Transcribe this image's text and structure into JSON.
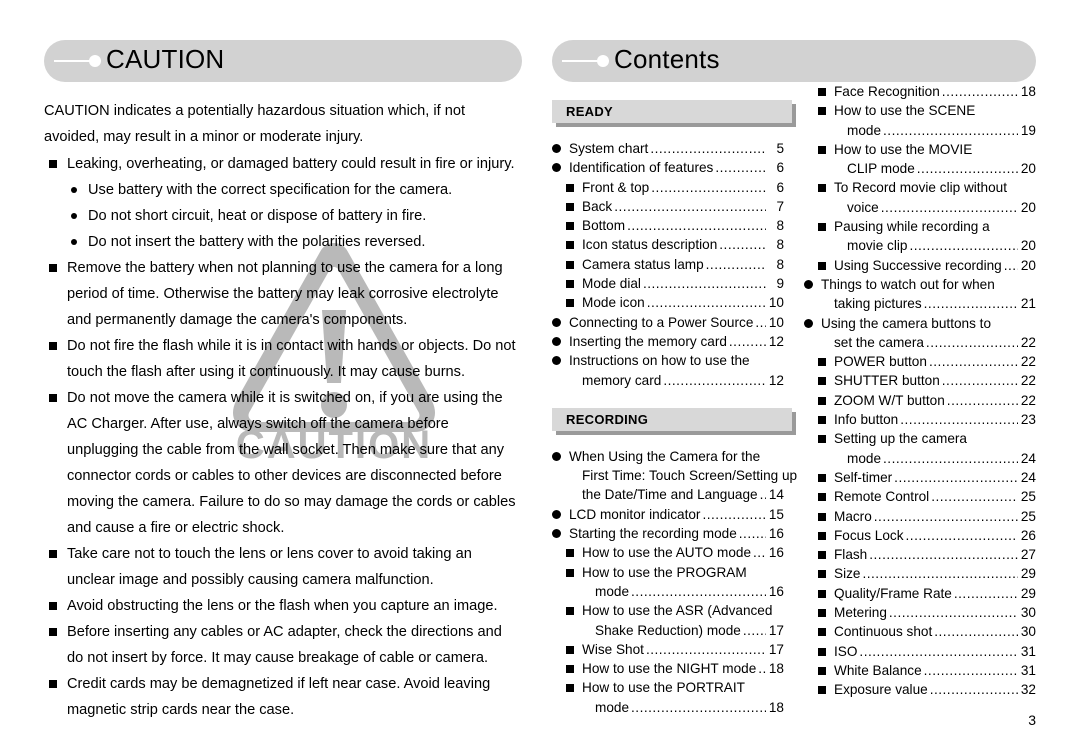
{
  "left": {
    "header_title": "CAUTION",
    "lead": "CAUTION indicates a potentially hazardous situation which, if not avoided, may result in a minor or moderate injury.",
    "items": [
      {
        "text": "Leaking, overheating, or damaged battery could result in fire or injury.",
        "subs": [
          "Use battery with the correct specification for the camera.",
          "Do not short circuit, heat or dispose of battery in fire.",
          "Do not insert the battery with the polarities reversed."
        ]
      },
      {
        "text": "Remove the battery when not planning to use the camera for a long period of time. Otherwise the battery may leak corrosive electrolyte and permanently damage the camera's components.",
        "subs": []
      },
      {
        "text": "Do not fire the flash while it is in contact with hands or objects. Do not touch the flash after using it continuously. It may cause burns.",
        "subs": []
      },
      {
        "text": "Do not move the camera while it is switched on, if you are using the AC Charger. After use, always switch off the camera before unplugging the cable from the wall socket. Then make sure that any connector cords or cables to other devices are disconnected before moving the camera. Failure to do so may damage the cords or cables and cause a fire or electric shock.",
        "subs": []
      },
      {
        "text": "Take care not to touch the lens or lens cover to avoid taking an unclear image and possibly causing camera malfunction.",
        "subs": []
      },
      {
        "text": "Avoid obstructing the lens or the flash when you capture an image.",
        "subs": []
      },
      {
        "text": "Before inserting any cables or AC adapter, check the directions and do not insert by force. It may cause breakage of cable or camera.",
        "subs": []
      },
      {
        "text": "Credit cards may be demagnetized if left near case. Avoid leaving magnetic strip cards near the case.",
        "subs": []
      }
    ],
    "watermark_text": "CAUTION"
  },
  "right": {
    "header_title": "Contents",
    "section_ready": "READY",
    "section_recording": "RECORDING",
    "column_a": [
      {
        "level": 1,
        "text": "System chart",
        "page": "5",
        "lead": true
      },
      {
        "level": 1,
        "text": "Identification of features",
        "page": "6",
        "lead": true
      },
      {
        "level": 2,
        "text": "Front & top",
        "page": "6",
        "lead": true
      },
      {
        "level": 2,
        "text": "Back",
        "page": "7",
        "lead": true
      },
      {
        "level": 2,
        "text": "Bottom",
        "page": "8",
        "lead": true
      },
      {
        "level": 2,
        "text": "Icon status description",
        "page": "8",
        "lead": true
      },
      {
        "level": 2,
        "text": "Camera status lamp",
        "page": "8",
        "lead": true
      },
      {
        "level": 2,
        "text": "Mode dial",
        "page": "9",
        "lead": true
      },
      {
        "level": 2,
        "text": "Mode icon",
        "page": "10",
        "lead": true
      },
      {
        "level": 1,
        "text": "Connecting to a Power Source",
        "page": "10",
        "lead": true
      },
      {
        "level": 1,
        "text": "Inserting the memory card",
        "page": "12",
        "lead": true
      },
      {
        "level": 1,
        "text": "Instructions on how to use the",
        "page": "",
        "lead": false
      },
      {
        "level": "c1",
        "text": "memory card",
        "page": "12",
        "lead": true
      }
    ],
    "column_a2": [
      {
        "level": 1,
        "text": "When Using the Camera for the",
        "page": "",
        "lead": false
      },
      {
        "level": "c1",
        "text": "First Time: Touch Screen/Setting up",
        "page": "",
        "lead": false
      },
      {
        "level": "c1",
        "text": "the Date/Time and Language",
        "page": "14",
        "lead": true
      },
      {
        "level": 1,
        "text": "LCD monitor indicator",
        "page": "15",
        "lead": true
      },
      {
        "level": 1,
        "text": "Starting the recording mode",
        "page": "16",
        "lead": true
      },
      {
        "level": 2,
        "text": "How to use the AUTO mode",
        "page": "16",
        "lead": true
      },
      {
        "level": 2,
        "text": "How to use the PROGRAM",
        "page": "",
        "lead": false
      },
      {
        "level": "c2",
        "text": "mode",
        "page": "16",
        "lead": true
      },
      {
        "level": 2,
        "text": "How to use the ASR (Advanced",
        "page": "",
        "lead": false
      },
      {
        "level": "c2",
        "text": "Shake Reduction) mode",
        "page": "17",
        "lead": true
      },
      {
        "level": 2,
        "text": "Wise Shot",
        "page": "17",
        "lead": true
      },
      {
        "level": 2,
        "text": "How to use the NIGHT mode",
        "page": "18",
        "lead": true
      },
      {
        "level": 2,
        "text": "How to use the PORTRAIT",
        "page": "",
        "lead": false
      },
      {
        "level": "c2",
        "text": "mode",
        "page": "18",
        "lead": true
      }
    ],
    "column_b": [
      {
        "level": 2,
        "text": "Face Recognition",
        "page": "18",
        "lead": true
      },
      {
        "level": 2,
        "text": "How to use the SCENE",
        "page": "",
        "lead": false
      },
      {
        "level": "c2",
        "text": "mode",
        "page": "19",
        "lead": true
      },
      {
        "level": 2,
        "text": "How to use the MOVIE",
        "page": "",
        "lead": false
      },
      {
        "level": "c2",
        "text": "CLIP mode",
        "page": "20",
        "lead": true
      },
      {
        "level": 2,
        "text": "To Record movie clip without",
        "page": "",
        "lead": false
      },
      {
        "level": "c2",
        "text": "voice",
        "page": "20",
        "lead": true
      },
      {
        "level": 2,
        "text": "Pausing while recording a",
        "page": "",
        "lead": false
      },
      {
        "level": "c2",
        "text": "movie clip",
        "page": "20",
        "lead": true
      },
      {
        "level": 2,
        "text": "Using Successive recording",
        "page": "20",
        "lead": true
      },
      {
        "level": 1,
        "text": "Things to watch out for when",
        "page": "",
        "lead": false
      },
      {
        "level": "c1",
        "text": "taking pictures",
        "page": "21",
        "lead": true
      },
      {
        "level": 1,
        "text": "Using the camera buttons to",
        "page": "",
        "lead": false
      },
      {
        "level": "c1",
        "text": "set the camera",
        "page": "22",
        "lead": true
      },
      {
        "level": 2,
        "text": "POWER button",
        "page": "22",
        "lead": true
      },
      {
        "level": 2,
        "text": "SHUTTER button",
        "page": "22",
        "lead": true
      },
      {
        "level": 2,
        "text": "ZOOM W/T button",
        "page": "22",
        "lead": true
      },
      {
        "level": 2,
        "text": "Info button",
        "page": "23",
        "lead": true
      },
      {
        "level": 2,
        "text": "Setting up the camera",
        "page": "",
        "lead": false
      },
      {
        "level": "c2",
        "text": "mode",
        "page": "24",
        "lead": true
      },
      {
        "level": 2,
        "text": "Self-timer",
        "page": "24",
        "lead": true
      },
      {
        "level": 2,
        "text": "Remote Control",
        "page": "25",
        "lead": true
      },
      {
        "level": 2,
        "text": "Macro",
        "page": "25",
        "lead": true
      },
      {
        "level": 2,
        "text": "Focus Lock",
        "page": "26",
        "lead": true
      },
      {
        "level": 2,
        "text": "Flash",
        "page": "27",
        "lead": true
      },
      {
        "level": 2,
        "text": "Size",
        "page": "29",
        "lead": true
      },
      {
        "level": 2,
        "text": "Quality/Frame Rate",
        "page": "29",
        "lead": true
      },
      {
        "level": 2,
        "text": "Metering",
        "page": "30",
        "lead": true
      },
      {
        "level": 2,
        "text": "Continuous shot",
        "page": "30",
        "lead": true
      },
      {
        "level": 2,
        "text": "ISO",
        "page": "31",
        "lead": true
      },
      {
        "level": 2,
        "text": "White Balance",
        "page": "31",
        "lead": true
      },
      {
        "level": 2,
        "text": "Exposure value",
        "page": "32",
        "lead": true
      }
    ]
  },
  "folio": "3",
  "colors": {
    "pill_bg": "#d2d2d2",
    "section_bg": "#d8d8d8",
    "section_shadow": "#9a9a9a",
    "watermark": "#b9b9b9",
    "text": "#000000"
  }
}
